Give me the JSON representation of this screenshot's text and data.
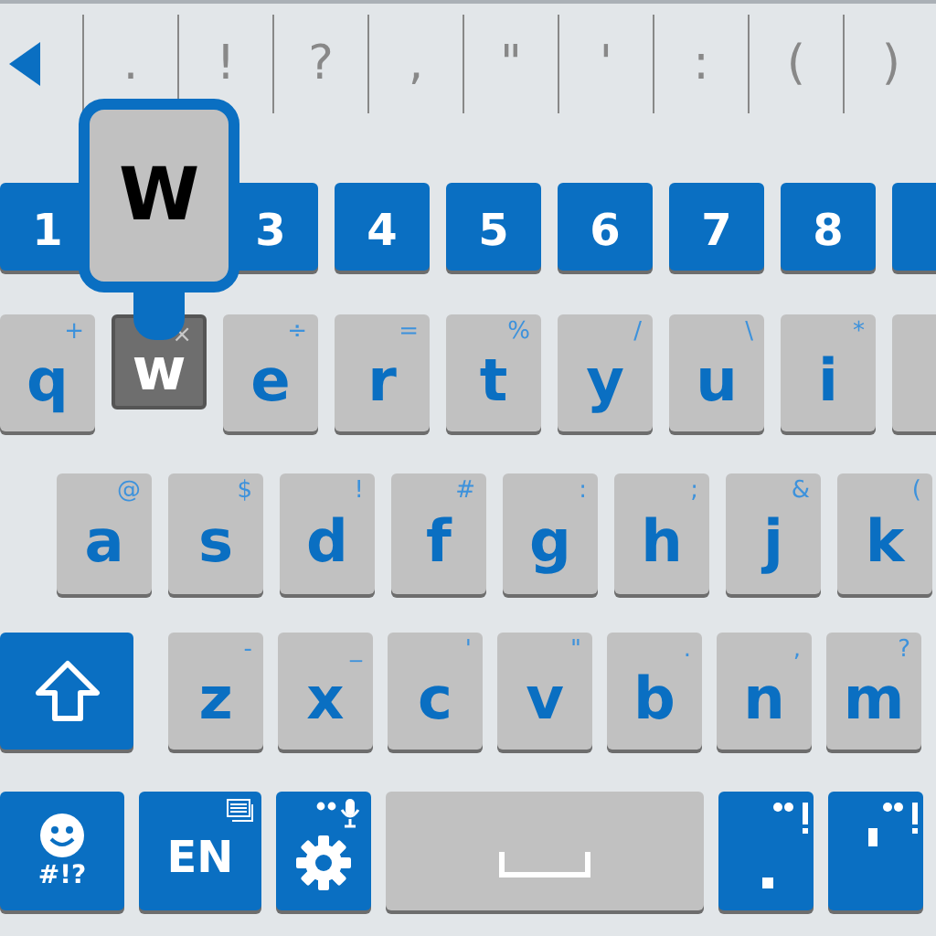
{
  "suggestion_bar": {
    "symbols": [
      ".",
      "!",
      "?",
      ",",
      "\"",
      "'",
      ":",
      "(",
      ")"
    ]
  },
  "popup": {
    "label": "W"
  },
  "rows": [
    {
      "keys": [
        {
          "kind": "number",
          "label": "1"
        },
        {
          "kind": "spacer"
        },
        {
          "kind": "number",
          "label": "3"
        },
        {
          "kind": "number",
          "label": "4"
        },
        {
          "kind": "number",
          "label": "5"
        },
        {
          "kind": "number",
          "label": "6"
        },
        {
          "kind": "number",
          "label": "7"
        },
        {
          "kind": "number",
          "label": "8"
        },
        {
          "kind": "number"
        }
      ]
    },
    {
      "keys": [
        {
          "kind": "letter",
          "label": "q",
          "hint": "+",
          "pressed": false
        },
        {
          "kind": "letter",
          "label": "w",
          "hint": "×",
          "pressed": true
        },
        {
          "kind": "letter",
          "label": "e",
          "hint": "÷",
          "pressed": false
        },
        {
          "kind": "letter",
          "label": "r",
          "hint": "=",
          "pressed": false
        },
        {
          "kind": "letter",
          "label": "t",
          "hint": "%",
          "pressed": false
        },
        {
          "kind": "letter",
          "label": "y",
          "hint": "/",
          "pressed": false
        },
        {
          "kind": "letter",
          "label": "u",
          "hint": "\\",
          "pressed": false
        },
        {
          "kind": "letter",
          "label": "i",
          "hint": "*",
          "pressed": false
        },
        {
          "kind": "letter",
          "pressed": false
        }
      ]
    },
    {
      "keys": [
        {
          "kind": "letter",
          "label": "a",
          "hint": "@",
          "pressed": false
        },
        {
          "kind": "letter",
          "label": "s",
          "hint": "$",
          "pressed": false
        },
        {
          "kind": "letter",
          "label": "d",
          "hint": "!",
          "pressed": false
        },
        {
          "kind": "letter",
          "label": "f",
          "hint": "#",
          "pressed": false
        },
        {
          "kind": "letter",
          "label": "g",
          "hint": ":",
          "pressed": false
        },
        {
          "kind": "letter",
          "label": "h",
          "hint": ";",
          "pressed": false
        },
        {
          "kind": "letter",
          "label": "j",
          "hint": "&",
          "pressed": false
        },
        {
          "kind": "letter",
          "label": "k",
          "hint": "(",
          "pressed": false
        }
      ]
    },
    {
      "keys": [
        {
          "kind": "shift"
        },
        {
          "kind": "letter",
          "label": "z",
          "hint": "-",
          "pressed": false
        },
        {
          "kind": "letter",
          "label": "x",
          "hint": "_",
          "pressed": false
        },
        {
          "kind": "letter",
          "label": "c",
          "hint": "'",
          "pressed": false
        },
        {
          "kind": "letter",
          "label": "v",
          "hint": "\"",
          "pressed": false
        },
        {
          "kind": "letter",
          "label": "b",
          "hint": ".",
          "pressed": false
        },
        {
          "kind": "letter",
          "label": "n",
          "hint": ",",
          "pressed": false
        },
        {
          "kind": "letter",
          "label": "m",
          "hint": "?",
          "pressed": false
        }
      ]
    },
    {
      "keys": [
        {
          "kind": "emoji",
          "label": "#!?"
        },
        {
          "kind": "language",
          "label": "EN"
        },
        {
          "kind": "settings"
        },
        {
          "kind": "space"
        },
        {
          "kind": "period"
        },
        {
          "kind": "punctuation"
        }
      ]
    }
  ]
}
